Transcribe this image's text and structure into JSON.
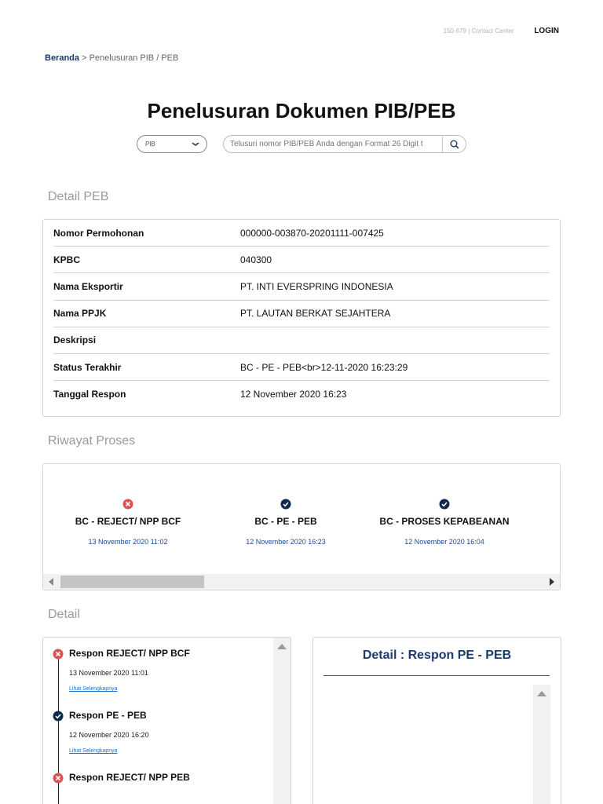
{
  "header": {
    "contact": "150-679 | Contact Center",
    "login_label": "LOGIN"
  },
  "breadcrumb": {
    "home": "Beranda",
    "separator": " > ",
    "current": "Penelusuran PIB / PEB"
  },
  "page_title": "Penelusuran Dokumen PIB/PEB",
  "search": {
    "type_selected": "PIB",
    "placeholder": "Telusuri nomor PIB/PEB Anda dengan Format 26 Digit t",
    "value": ""
  },
  "detail_peb": {
    "title": "Detail PEB",
    "rows": [
      {
        "label": "Nomor Permohonan",
        "value": "000000-003870-20201111-007425"
      },
      {
        "label": "KPBC",
        "value": "040300"
      },
      {
        "label": "Nama Eksportir",
        "value": "PT. INTI EVERSPRING INDONESIA"
      },
      {
        "label": "Nama PPJK",
        "value": "PT. LAUTAN BERKAT SEJAHTERA"
      },
      {
        "label": "Deskripsi",
        "value": ""
      },
      {
        "label": "Status Terakhir",
        "value": "BC - PE - PEB<br>12-11-2020 16:23:29"
      },
      {
        "label": "Tanggal Respon",
        "value": "12 November 2020 16:23"
      }
    ]
  },
  "riwayat": {
    "title": "Riwayat Proses",
    "items": [
      {
        "status": "reject",
        "title": "BC - REJECT/ NPP BCF",
        "date": "13 November 2020 11:02"
      },
      {
        "status": "ok",
        "title": "BC - PE - PEB",
        "date": "12 November 2020 16:23"
      },
      {
        "status": "ok",
        "title": "BC - PROSES KEPABEANAN",
        "date": "12 November 2020 16:04"
      }
    ]
  },
  "detail": {
    "title": "Detail",
    "timeline": [
      {
        "status": "reject",
        "title": "Respon REJECT/ NPP BCF",
        "date": "13 November 2020 11:01",
        "link": "Lihat Selengkapnya"
      },
      {
        "status": "ok",
        "title": "Respon PE - PEB",
        "date": "12 November 2020 16:20",
        "link": "Lihat Selengkapnya"
      },
      {
        "status": "reject",
        "title": "Respon REJECT/ NPP PEB",
        "date": "",
        "link": ""
      }
    ],
    "panel_title": "Detail : Respon PE - PEB"
  },
  "colors": {
    "navy": "#1a3a6b",
    "link_blue": "#1a4d8f",
    "reject_red": "#e05252",
    "ok_navy": "#10294d"
  }
}
